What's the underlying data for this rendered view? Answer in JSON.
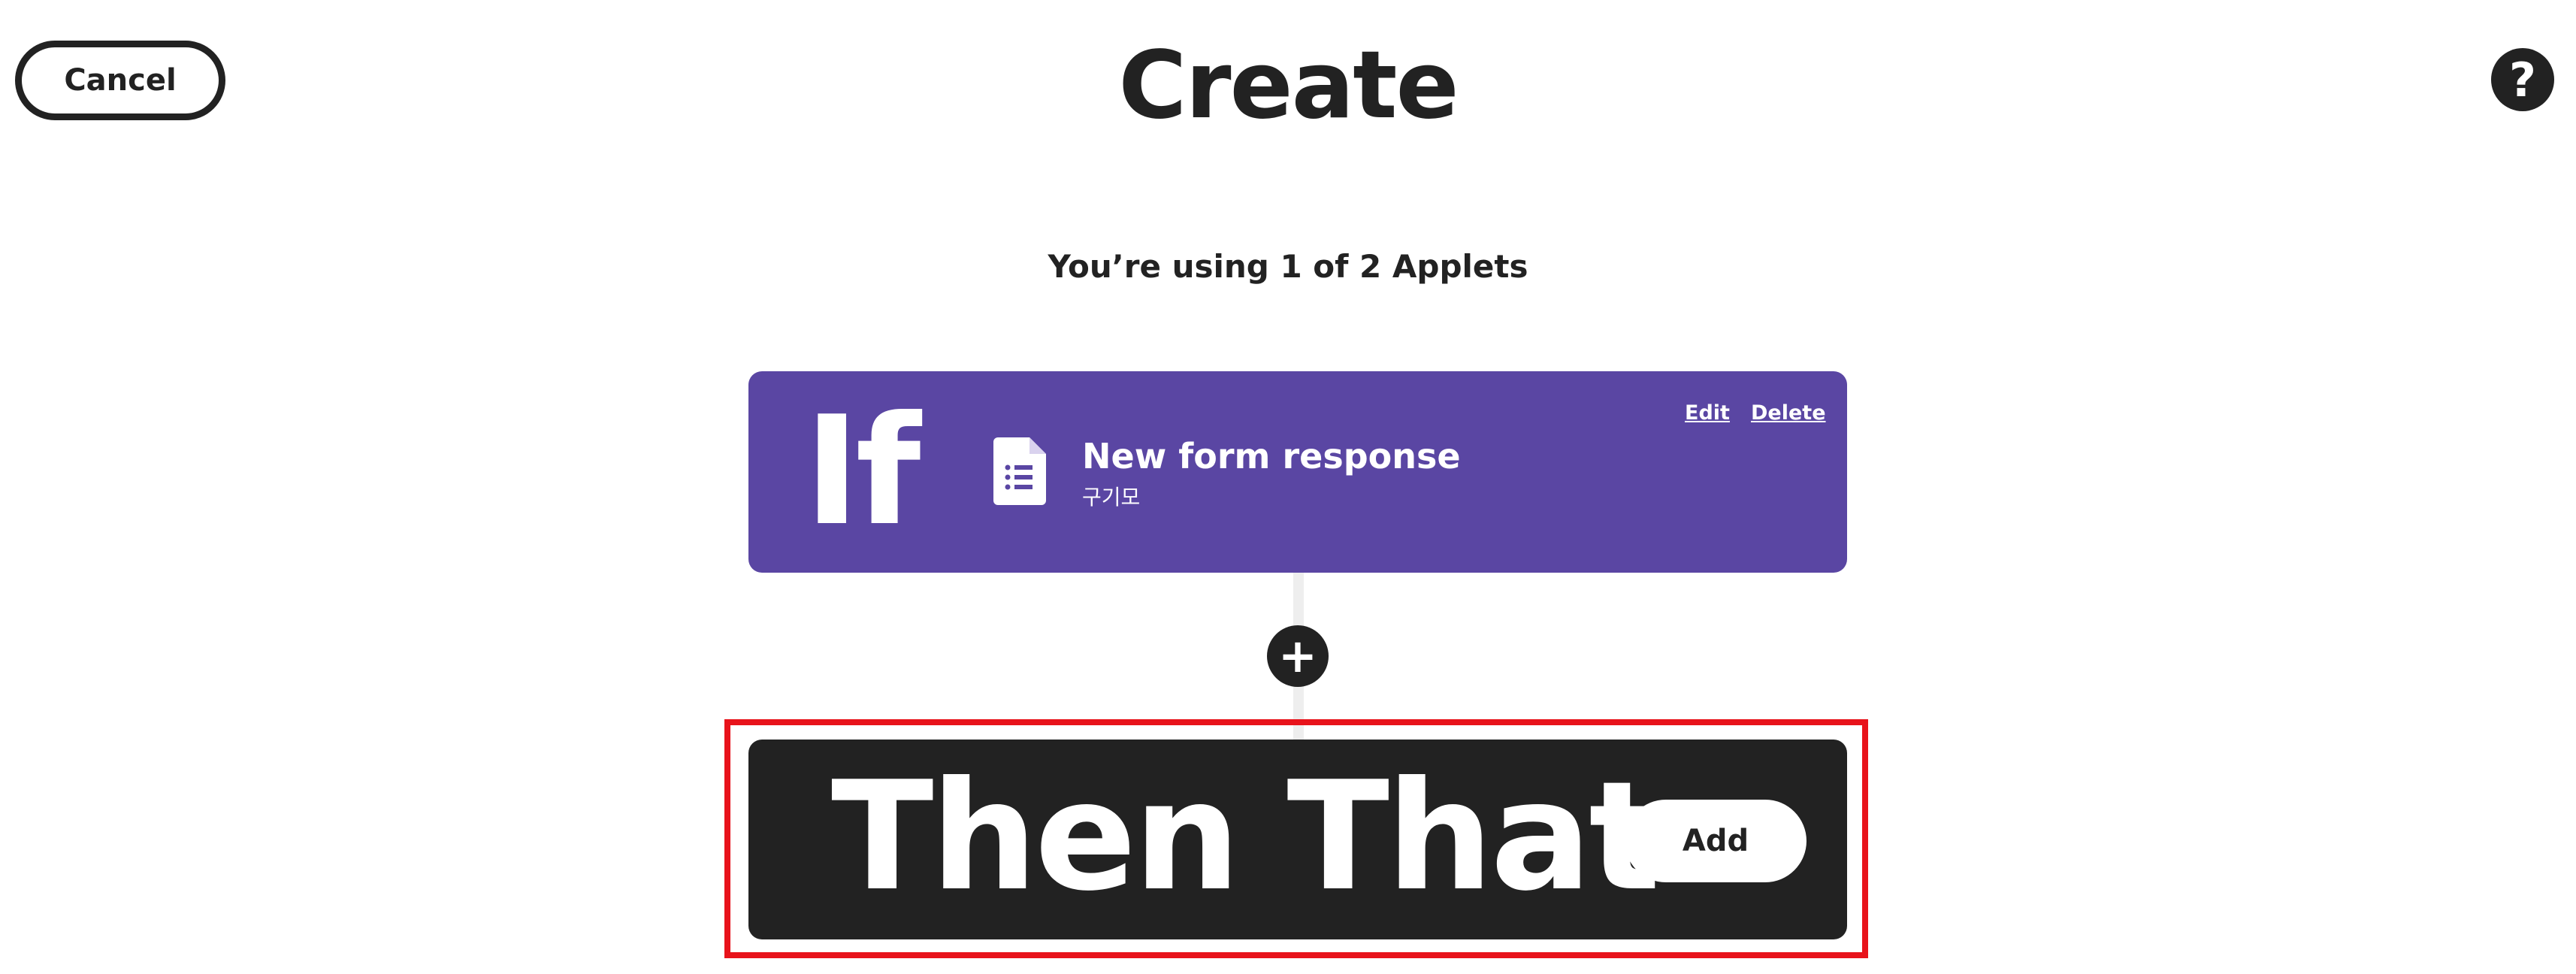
{
  "header": {
    "cancel_label": "Cancel",
    "title": "Create",
    "help_symbol": "?"
  },
  "usage_text": "You’re using 1 of 2 Applets",
  "trigger": {
    "if_label": "If",
    "icon": "google-forms-icon",
    "name": "New form response",
    "subtitle": "구기모",
    "edit_label": "Edit",
    "delete_label": "Delete",
    "color": "#5a46a3"
  },
  "plus_symbol": "+",
  "action": {
    "then_label": "Then That",
    "add_label": "Add",
    "color": "#222222"
  },
  "highlight_color": "#e8131b"
}
